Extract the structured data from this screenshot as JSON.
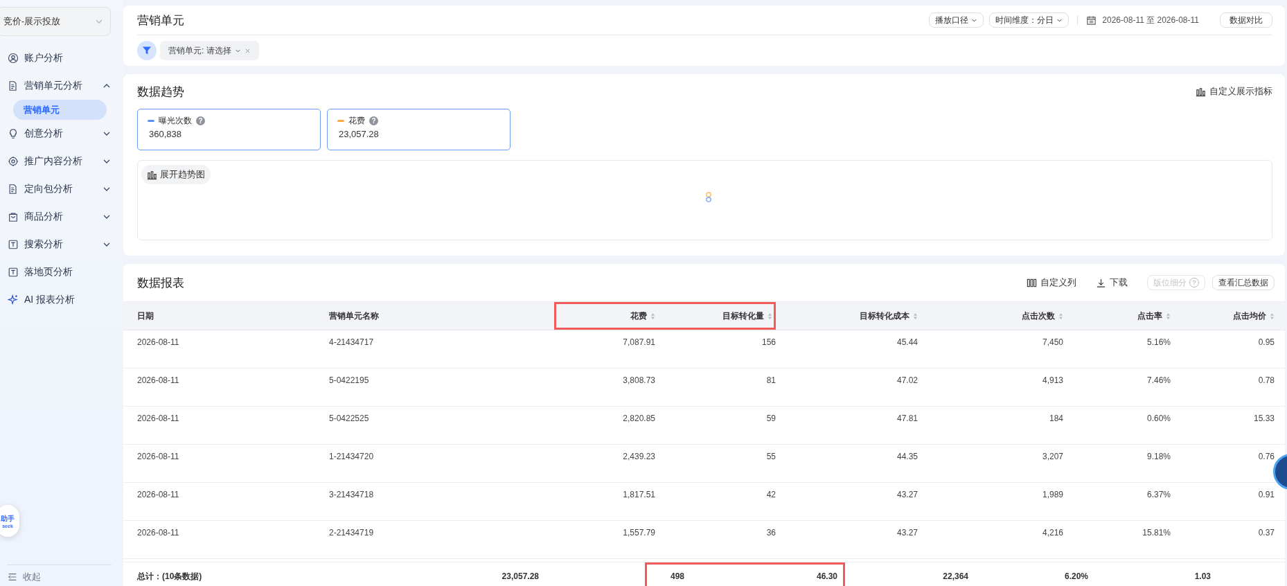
{
  "sidebar": {
    "account_switcher": "竞价-展示投放",
    "items": [
      {
        "label": "账户分析",
        "kind": "user"
      },
      {
        "label": "营销单元分析",
        "kind": "doc",
        "expanded": true,
        "children": [
          {
            "label": "营销单元",
            "selected": true
          }
        ]
      },
      {
        "label": "创意分析",
        "kind": "bulb",
        "expanded": false
      },
      {
        "label": "推广内容分析",
        "kind": "target",
        "expanded": false
      },
      {
        "label": "定向包分析",
        "kind": "doc",
        "expanded": false
      },
      {
        "label": "商品分析",
        "kind": "bag",
        "expanded": false
      },
      {
        "label": "搜索分析",
        "kind": "text",
        "expanded": false
      },
      {
        "label": "落地页分析",
        "kind": "text"
      },
      {
        "label": "AI 报表分析",
        "kind": "sparkle"
      }
    ],
    "collapse": "收起"
  },
  "assistant": {
    "title": "助手",
    "subtitle": "seek"
  },
  "header": {
    "title": "营销单元",
    "controls": [
      {
        "label": "播放口径",
        "dropdown": true
      },
      {
        "label": "时间维度：分日",
        "dropdown": true
      }
    ],
    "date_range": "2026-08-11 至 2026-08-11",
    "compare_button": "数据对比",
    "filter_chip": {
      "label": "营销单元: 请选择",
      "removable": true
    }
  },
  "trend": {
    "title": "数据趋势",
    "customize": "自定义展示指标",
    "metrics": [
      {
        "label": "曝光次数",
        "help": "?",
        "value": "360,838",
        "color": "#5b8ff9",
        "selected": true
      },
      {
        "label": "花费",
        "help": "?",
        "value": "23,057.28",
        "color": "#ffa940",
        "selected": true
      }
    ],
    "expand_button": "展开趋势图",
    "loading": true
  },
  "report": {
    "title": "数据报表",
    "actions": [
      {
        "label": "自定义列",
        "kind": "columns"
      },
      {
        "label": "下载",
        "kind": "download"
      },
      {
        "label": "版位细分",
        "kind": "button",
        "disabled": true,
        "help": "?"
      },
      {
        "label": "查看汇总数据",
        "kind": "button",
        "disabled": false
      }
    ],
    "columns": [
      {
        "label": "日期",
        "sortable": false,
        "highlighted": false
      },
      {
        "label": "营销单元名称",
        "sortable": false,
        "highlighted": false
      },
      {
        "label": "花费",
        "sortable": true,
        "highlighted": true
      },
      {
        "label": "目标转化量",
        "sortable": true,
        "highlighted": true
      },
      {
        "label": "目标转化成本",
        "sortable": true,
        "highlighted": false
      },
      {
        "label": "点击次数",
        "sortable": true,
        "highlighted": false
      },
      {
        "label": "点击率",
        "sortable": true,
        "highlighted": false
      },
      {
        "label": "点击均价",
        "sortable": true,
        "highlighted": false
      }
    ],
    "rows": [
      [
        "2026-08-11",
        "4-21434717",
        "7,087.91",
        "156",
        "45.44",
        "7,450",
        "5.16%",
        "0.95"
      ],
      [
        "2026-08-11",
        "5-0422195",
        "3,808.73",
        "81",
        "47.02",
        "4,913",
        "7.46%",
        "0.78"
      ],
      [
        "2026-08-11",
        "5-0422525",
        "2,820.85",
        "59",
        "47.81",
        "184",
        "0.60%",
        "15.33"
      ],
      [
        "2026-08-11",
        "1-21434720",
        "2,439.23",
        "55",
        "44.35",
        "3,207",
        "9.18%",
        "0.76"
      ],
      [
        "2026-08-11",
        "3-21434718",
        "1,817.51",
        "42",
        "43.27",
        "1,989",
        "6.37%",
        "0.91"
      ],
      [
        "2026-08-11",
        "2-21434719",
        "1,557.79",
        "36",
        "43.27",
        "4,216",
        "15.81%",
        "0.37"
      ]
    ],
    "totals": {
      "label": "总计：(10条数据)",
      "cells": [
        {
          "value": "23,057.28",
          "highlighted": false
        },
        {
          "value": "498",
          "highlighted": true
        },
        {
          "value": "46.30",
          "highlighted": true
        },
        {
          "value": "22,364",
          "highlighted": false
        },
        {
          "value": "6.20%",
          "highlighted": false
        },
        {
          "value": "1.03",
          "highlighted": false
        }
      ]
    }
  }
}
